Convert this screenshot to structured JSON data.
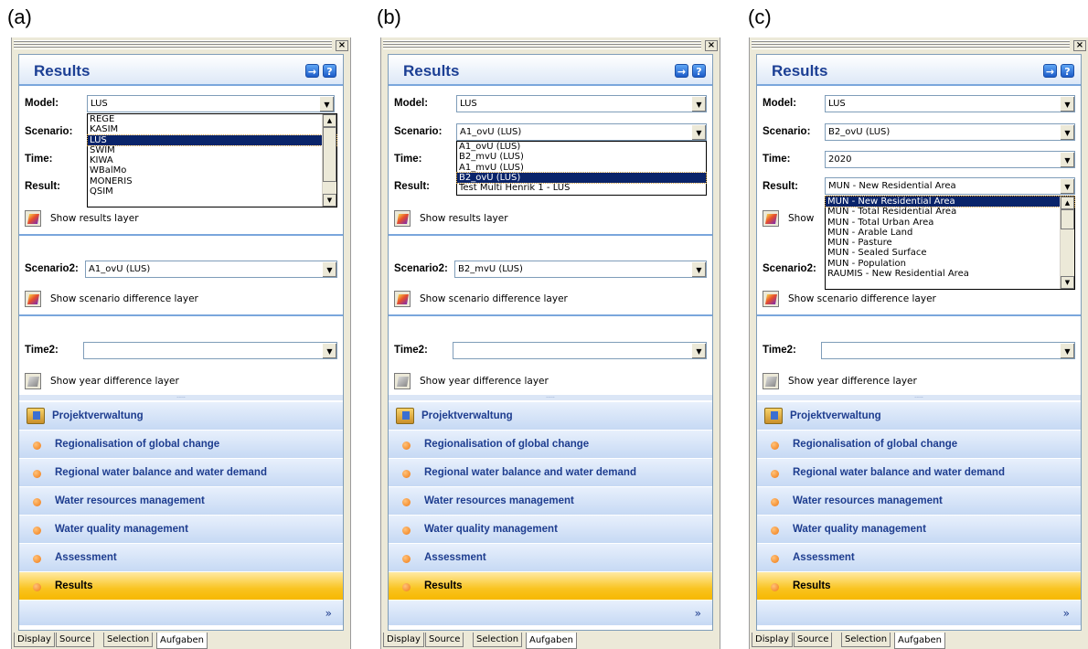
{
  "figure_labels": [
    "(a)",
    "(b)",
    "(c)"
  ],
  "close_glyph": "×",
  "header": {
    "title": "Results",
    "next_icon": "→",
    "help_icon": "?"
  },
  "labels": {
    "model": "Model:",
    "scenario": "Scenario:",
    "time": "Time:",
    "result": "Result:",
    "scenario2": "Scenario2:",
    "time2": "Time2:",
    "show_results_layer": "Show results layer",
    "show_scenario_diff": "Show scenario difference layer",
    "show_year_diff": "Show year difference layer",
    "show_truncated": "Show"
  },
  "combo_arrow": "▼",
  "splitter_dots": ".....",
  "tasks": [
    "Projektverwaltung",
    "Regionalisation of global change",
    "Regional water balance and water demand",
    "Water resources management",
    "Water quality management",
    "Assessment",
    "Results"
  ],
  "more_chevron": "»",
  "tabs": [
    "Display",
    "Source",
    "Selection",
    "Aufgaben"
  ],
  "panel_a": {
    "model": "LUS",
    "model_options": [
      "REGE",
      "KASIM",
      "LUS",
      "SWIM",
      "KIWA",
      "WBalMo",
      "MONERIS",
      "QSIM"
    ],
    "model_selected_index": 2,
    "scenario2": "A1_ovU (LUS)",
    "time2": ""
  },
  "panel_b": {
    "model": "LUS",
    "scenario": "A1_ovU (LUS)",
    "scenario_options": [
      "A1_ovU (LUS)",
      "B2_mvU (LUS)",
      "A1_mvU (LUS)",
      "B2_ovU (LUS)",
      "Test Multi Henrik 1 - LUS"
    ],
    "scenario_selected_index": 3,
    "scenario2": "B2_mvU (LUS)",
    "time2": ""
  },
  "panel_c": {
    "model": "LUS",
    "scenario": "B2_ovU (LUS)",
    "time": "2020",
    "result": "MUN - New Residential Area",
    "result_options": [
      "MUN - New Residential Area",
      "MUN - Total Residential Area",
      "MUN - Total Urban Area",
      "MUN - Arable Land",
      "MUN - Pasture",
      "MUN - Sealed Surface",
      "MUN - Population",
      "RAUMIS - New Residential Area"
    ],
    "result_selected_index": 0,
    "time2": ""
  }
}
